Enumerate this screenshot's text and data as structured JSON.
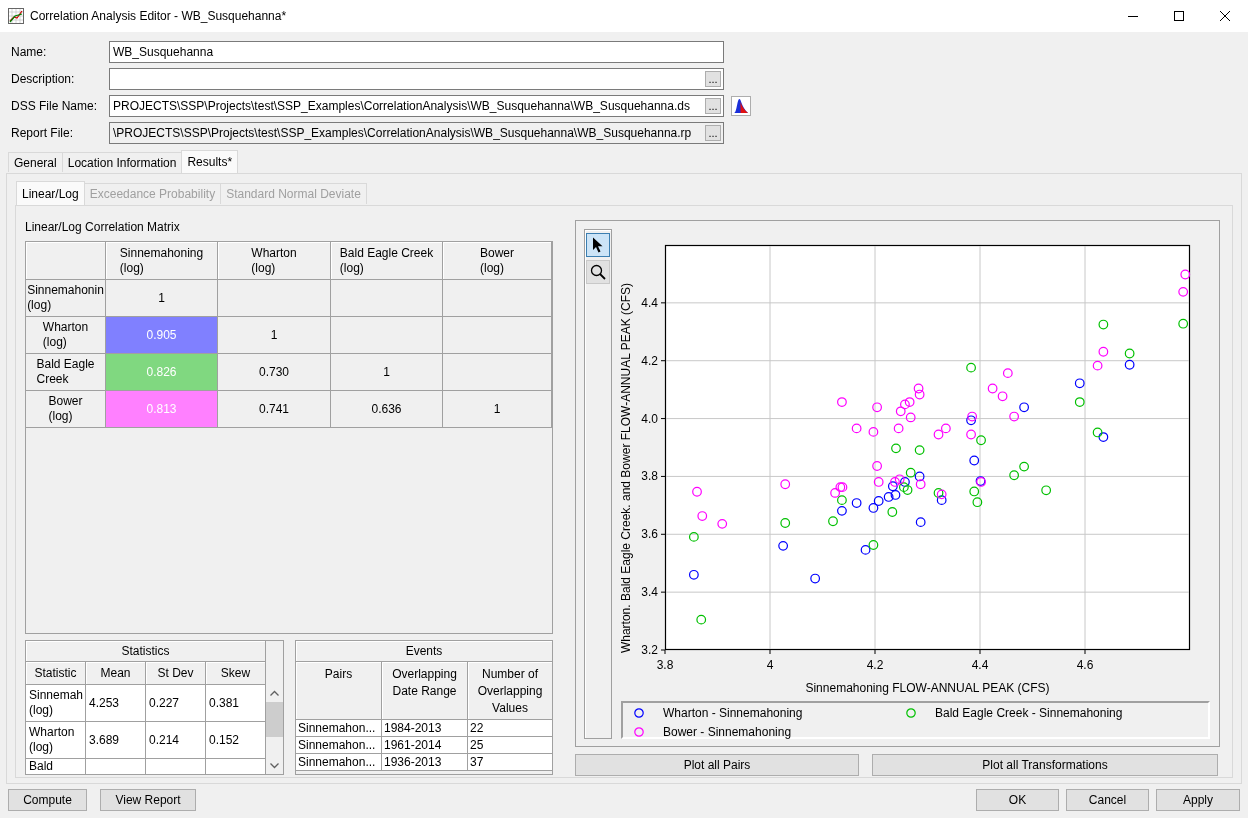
{
  "window": {
    "title": "Correlation Analysis Editor - WB_Susquehanna*"
  },
  "form": [
    {
      "label": "Name:",
      "value": "WB_Susquehanna",
      "disabled": false
    },
    {
      "label": "Description:",
      "button": "...",
      "disabled": false
    },
    {
      "label": "DSS File Name:",
      "value": "PROJECTS\\SSP\\Projects\\test\\SSP_Examples\\CorrelationAnalysis\\WB_Susquehanna\\WB_Susquehanna.ds",
      "button": "...",
      "plot_button": true,
      "disabled": false
    },
    {
      "label": "Report File:",
      "value": "\\PROJECTS\\SSP\\Projects\\test\\SSP_Examples\\CorrelationAnalysis\\WB_Susquehanna\\WB_Susquehanna.rp",
      "button": "...",
      "disabled": true
    }
  ],
  "tabs": [
    {
      "label": "General",
      "selected": false
    },
    {
      "label": "Location Information",
      "selected": false
    },
    {
      "label": "Results*",
      "selected": true
    }
  ],
  "subtabs": [
    {
      "label": "Linear/Log",
      "selected": true,
      "disabled": false
    },
    {
      "label": "Exceedance Probability",
      "selected": false,
      "disabled": true
    },
    {
      "label": "Standard Normal Deviate",
      "selected": false,
      "disabled": true
    }
  ],
  "matrix": {
    "title": "Linear/Log Correlation Matrix",
    "columns": [
      "Sinnemahoning\n(log)",
      "Wharton\n(log)",
      "Bald Eagle Creek\n(log)",
      "Bower\n(log)"
    ],
    "rows": [
      {
        "label": "Sinnemahonin\n(log)",
        "cells": [
          {
            "text": "1"
          }
        ]
      },
      {
        "label": "Wharton\n(log)",
        "cells": [
          {
            "text": "0.905",
            "color": "#8080ff"
          },
          {
            "text": "1"
          }
        ]
      },
      {
        "label": "Bald Eagle\nCreek",
        "cells": [
          {
            "text": "0.826",
            "color": "#80d880"
          },
          {
            "text": "0.730"
          },
          {
            "text": "1"
          }
        ]
      },
      {
        "label": "Bower\n(log)",
        "cells": [
          {
            "text": "0.813",
            "color": "#ff80ff"
          },
          {
            "text": "0.741"
          },
          {
            "text": "0.636"
          },
          {
            "text": "1"
          }
        ]
      }
    ]
  },
  "statistics": {
    "title": "Statistics",
    "columns": [
      "Statistic",
      "Mean",
      "St Dev",
      "Skew"
    ],
    "rows": [
      [
        "Sinnemah\n(log)",
        "4.253",
        "0.227",
        "0.381"
      ],
      [
        "Wharton\n(log)",
        "3.689",
        "0.214",
        "0.152"
      ],
      [
        "Bald"
      ]
    ]
  },
  "events": {
    "title": "Events",
    "columns": [
      "Pairs",
      "Overlapping\nDate Range",
      "Number of\nOverlapping\nValues"
    ],
    "rows": [
      [
        "Sinnemahon...",
        "1984-2013",
        "22"
      ],
      [
        "Sinnemahon...",
        "1961-2014",
        "25"
      ],
      [
        "Sinnemahon...",
        "1936-2013",
        "37"
      ]
    ]
  },
  "chart": {
    "tools": [
      {
        "kind": "pointer",
        "selected": true
      },
      {
        "kind": "zoom",
        "selected": false
      }
    ],
    "chart_data": {
      "type": "scatter",
      "xlabel": "Sinnemahoning FLOW-ANNUAL PEAK (CFS)",
      "ylabel": "Wharton. Bald Eagle Creek. and Bower FLOW-ANNUAL PEAK (CFS)",
      "xlim": [
        3.8,
        4.8
      ],
      "ylim": [
        3.2,
        4.6
      ],
      "xticks": [
        3.8,
        4,
        4.2,
        4.4,
        4.6
      ],
      "yticks": [
        3.2,
        3.4,
        3.6,
        3.8,
        {
          "value": 4,
          "label": "4.0"
        },
        4.2,
        4.4
      ],
      "grid": true,
      "series": [
        {
          "name": "Wharton - Sinnemahoning",
          "color": "#0000ff",
          "x": [
            3.855,
            4.025,
            4.086,
            4.182,
            4.137,
            4.165,
            4.197,
            4.207,
            4.226,
            4.239,
            4.234,
            4.257,
            4.285,
            4.287,
            4.327,
            4.383,
            4.389,
            4.401,
            4.484,
            4.59,
            4.635,
            4.685
          ],
          "values": [
            3.46,
            3.56,
            3.447,
            3.546,
            3.681,
            3.708,
            3.691,
            3.715,
            3.729,
            3.736,
            3.766,
            3.781,
            3.8,
            3.642,
            3.718,
            3.994,
            3.855,
            3.784,
            4.039,
            4.122,
            3.936,
            4.186
          ]
        },
        {
          "name": "Bald Eagle Creek - Sinnemahoning",
          "color": "#00c000",
          "x": [
            3.855,
            3.869,
            4.029,
            4.12,
            4.137,
            4.197,
            4.233,
            4.24,
            4.255,
            4.262,
            4.268,
            4.285,
            4.321,
            4.383,
            4.389,
            4.395,
            4.402,
            4.465,
            4.484,
            4.526,
            4.59,
            4.624,
            4.635,
            4.685,
            4.787
          ],
          "values": [
            3.591,
            3.305,
            3.639,
            3.645,
            3.718,
            3.563,
            3.677,
            3.897,
            3.763,
            3.753,
            3.813,
            3.891,
            3.743,
            4.176,
            3.748,
            3.711,
            3.925,
            3.804,
            3.834,
            3.752,
            4.057,
            3.952,
            4.325,
            4.225,
            4.328
          ]
        },
        {
          "name": "Bower - Sinnemahoning",
          "color": "#ff00ff",
          "x": [
            3.861,
            3.871,
            3.909,
            4.029,
            4.124,
            4.134,
            4.138,
            4.137,
            4.165,
            4.197,
            4.204,
            4.204,
            4.207,
            4.238,
            4.247,
            4.245,
            4.249,
            4.257,
            4.266,
            4.268,
            4.283,
            4.285,
            4.287,
            4.321,
            4.327,
            4.335,
            4.383,
            4.385,
            4.402,
            4.424,
            4.443,
            4.453,
            4.465,
            4.624,
            4.635,
            4.787,
            4.791
          ],
          "values": [
            3.747,
            3.663,
            3.636,
            3.773,
            3.743,
            3.763,
            3.763,
            4.057,
            3.966,
            3.954,
            4.039,
            3.836,
            3.781,
            3.781,
            3.79,
            3.966,
            4.025,
            4.049,
            4.057,
            4.004,
            4.104,
            4.083,
            3.773,
            3.945,
            3.738,
            3.966,
            3.945,
            4.007,
            3.781,
            4.104,
            4.077,
            4.157,
            4.007,
            4.183,
            4.231,
            4.438,
            4.498
          ]
        }
      ]
    },
    "buttons": [
      "Plot all Pairs",
      "Plot all Transformations"
    ]
  },
  "footer": {
    "left": [
      "Compute",
      "View Report"
    ],
    "right": [
      "OK",
      "Cancel",
      "Apply"
    ]
  }
}
